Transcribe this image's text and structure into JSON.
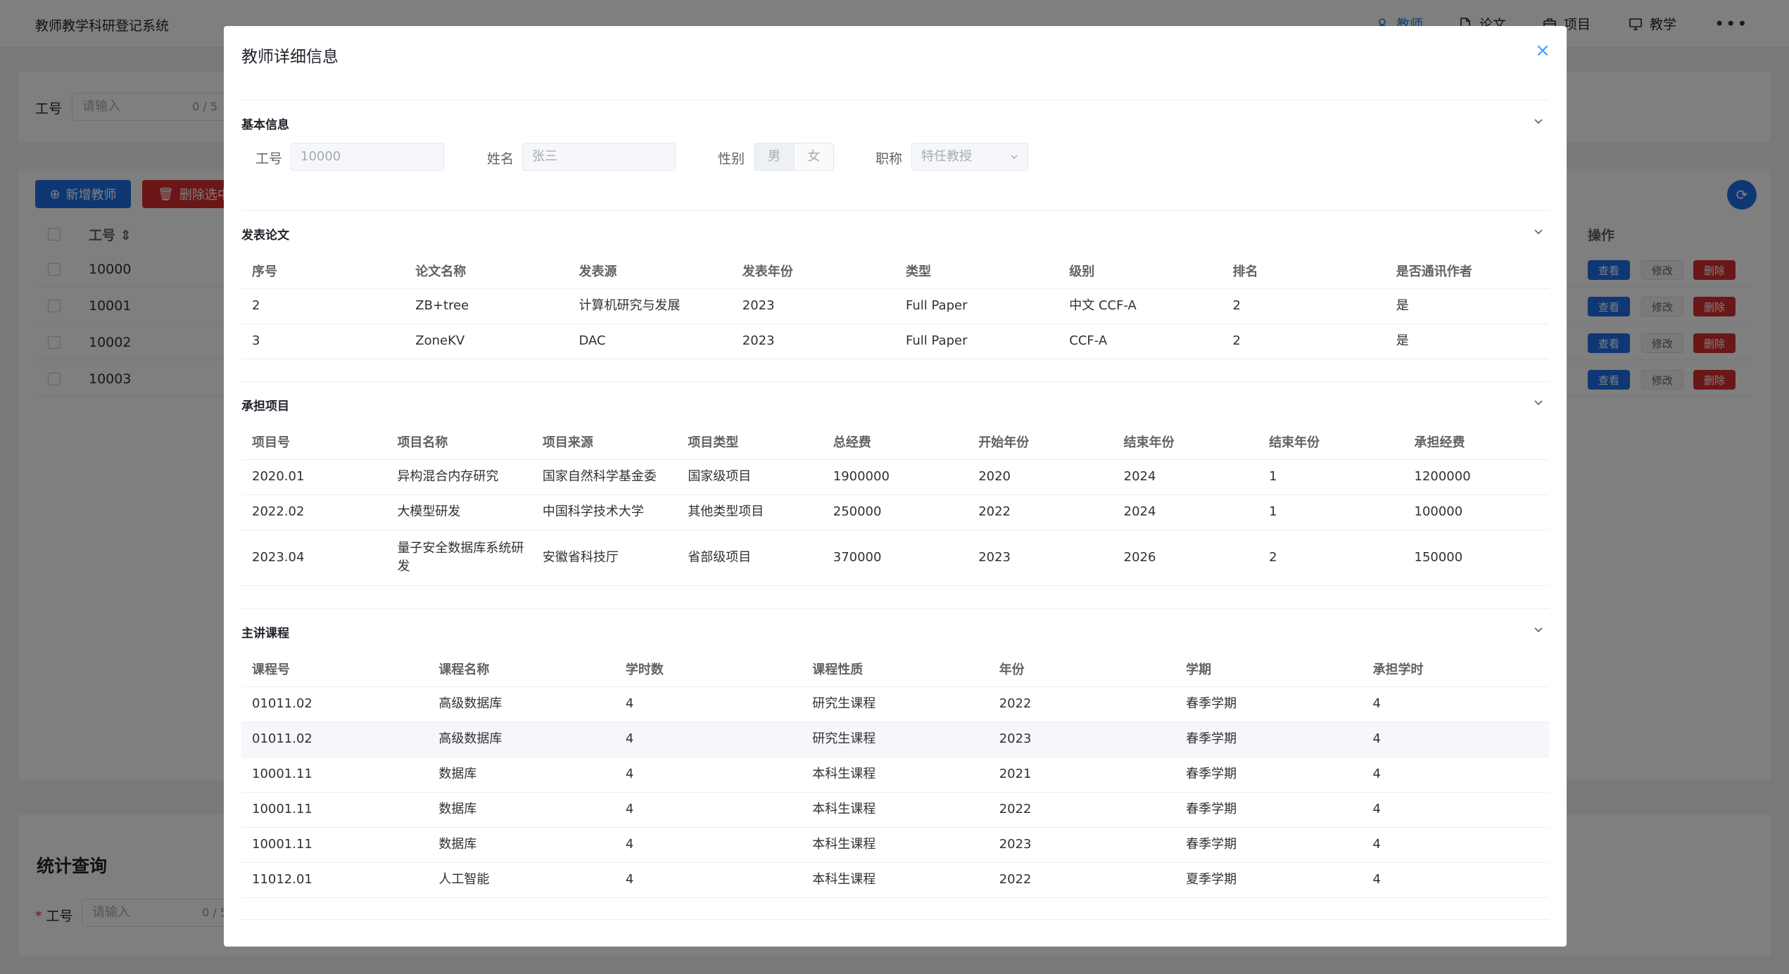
{
  "app": {
    "title": "教师教学科研登记系统",
    "nav": [
      {
        "label": "教师",
        "icon": "user-icon",
        "active": true
      },
      {
        "label": "论文",
        "icon": "document-icon",
        "active": false
      },
      {
        "label": "项目",
        "icon": "briefcase-icon",
        "active": false
      },
      {
        "label": "教学",
        "icon": "monitor-icon",
        "active": false
      }
    ],
    "more": "•••"
  },
  "search": {
    "label": "工号",
    "placeholder": "请输入",
    "counter": "0 / 5"
  },
  "toolbar": {
    "add_label": "新增教师",
    "delete_label": "删除选中"
  },
  "teacher_table": {
    "id_header": "工号",
    "ops_header": "操作",
    "rows": [
      "10000",
      "10001",
      "10002",
      "10003"
    ],
    "view_label": "查看",
    "edit_label": "修改",
    "delete_label": "删除"
  },
  "stats": {
    "title": "统计查询",
    "required_mark": "*",
    "label": "工号",
    "placeholder": "请输入",
    "counter": "0 / 5"
  },
  "dialog": {
    "title": "教师详细信息",
    "close_icon": "×",
    "basic": {
      "title": "基本信息",
      "id_label": "工号",
      "id_value": "10000",
      "name_label": "姓名",
      "name_value": "张三",
      "gender_label": "性别",
      "gender_male": "男",
      "gender_female": "女",
      "title_label": "职称",
      "title_value": "特任教授"
    },
    "papers": {
      "title": "发表论文",
      "headers": [
        "序号",
        "论文名称",
        "发表源",
        "发表年份",
        "类型",
        "级别",
        "排名",
        "是否通讯作者"
      ],
      "rows": [
        [
          "2",
          "ZB+tree",
          "计算机研究与发展",
          "2023",
          "Full Paper",
          "中文 CCF-A",
          "2",
          "是"
        ],
        [
          "3",
          "ZoneKV",
          "DAC",
          "2023",
          "Full Paper",
          "CCF-A",
          "2",
          "是"
        ]
      ]
    },
    "projects": {
      "title": "承担项目",
      "headers": [
        "项目号",
        "项目名称",
        "项目来源",
        "项目类型",
        "总经费",
        "开始年份",
        "结束年份",
        "结束年份",
        "承担经费"
      ],
      "rows": [
        [
          "2020.01",
          "异构混合内存研究",
          "国家自然科学基金委",
          "国家级项目",
          "1900000",
          "2020",
          "2024",
          "1",
          "1200000"
        ],
        [
          "2022.02",
          "大模型研发",
          "中国科学技术大学",
          "其他类型项目",
          "250000",
          "2022",
          "2024",
          "1",
          "100000"
        ],
        [
          "2023.04",
          "量子安全数据库系统研发",
          "安徽省科技厅",
          "省部级项目",
          "370000",
          "2023",
          "2026",
          "2",
          "150000"
        ]
      ]
    },
    "courses": {
      "title": "主讲课程",
      "headers": [
        "课程号",
        "课程名称",
        "学时数",
        "课程性质",
        "年份",
        "学期",
        "承担学时"
      ],
      "rows": [
        [
          "01011.02",
          "高级数据库",
          "4",
          "研究生课程",
          "2022",
          "春季学期",
          "4"
        ],
        [
          "01011.02",
          "高级数据库",
          "4",
          "研究生课程",
          "2023",
          "春季学期",
          "4"
        ],
        [
          "10001.11",
          "数据库",
          "4",
          "本科生课程",
          "2021",
          "春季学期",
          "4"
        ],
        [
          "10001.11",
          "数据库",
          "4",
          "本科生课程",
          "2022",
          "春季学期",
          "4"
        ],
        [
          "10001.11",
          "数据库",
          "4",
          "本科生课程",
          "2023",
          "春季学期",
          "4"
        ],
        [
          "11012.01",
          "人工智能",
          "4",
          "本科生课程",
          "2022",
          "夏季学期",
          "4"
        ]
      ]
    }
  },
  "colors": {
    "primary": "#1e6fe6",
    "danger": "#d72f2f",
    "active_nav": "#1e80ff",
    "overlay": "rgba(0,0,0,0.5)"
  }
}
